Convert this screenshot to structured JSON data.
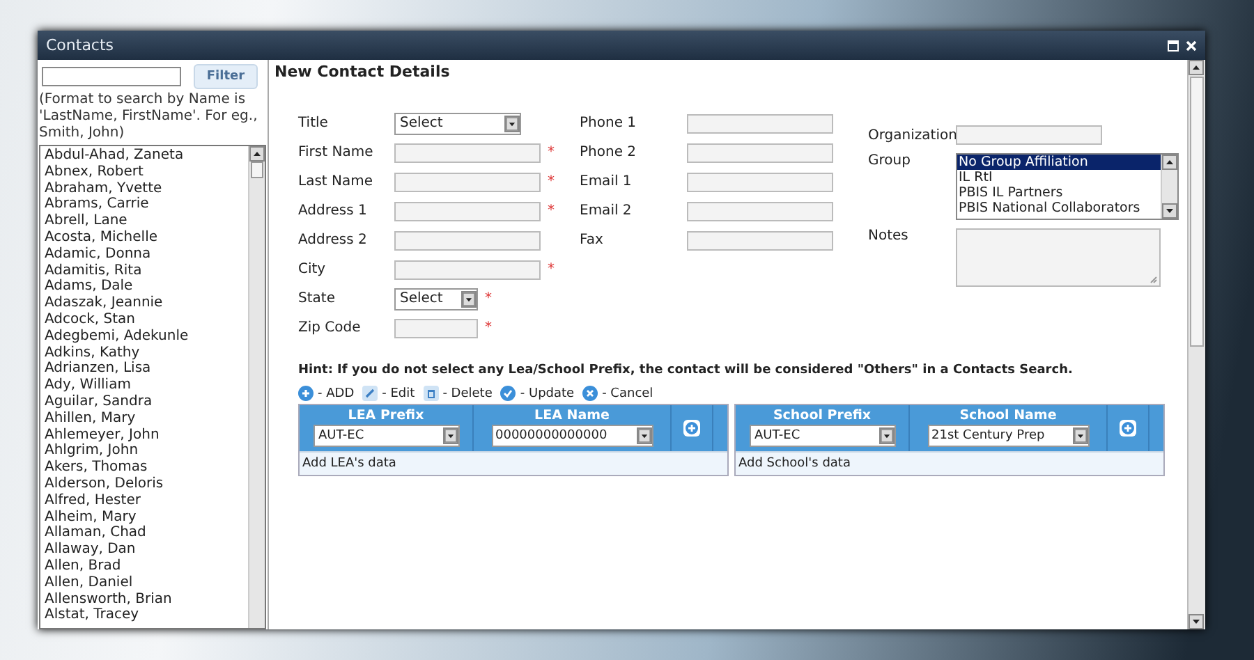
{
  "window": {
    "title": "Contacts"
  },
  "sidebar": {
    "filter_button": "Filter",
    "help": "(Format to search by Name is 'LastName, FirstName'. For eg., Smith, John)",
    "contacts": [
      "Abdul-Ahad, Zaneta",
      "Abnex, Robert",
      "Abraham, Yvette",
      "Abrams, Carrie",
      "Abrell, Lane",
      "Acosta, Michelle",
      "Adamic, Donna",
      "Adamitis, Rita",
      "Adams, Dale",
      "Adaszak, Jeannie",
      "Adcock, Stan",
      "Adegbemi, Adekunle",
      "Adkins, Kathy",
      "Adrianzen, Lisa",
      "Ady, William",
      "Aguilar, Sandra",
      "Ahillen, Mary",
      "Ahlemeyer, John",
      "Ahlgrim, John",
      "Akers, Thomas",
      "Alderson, Deloris",
      "Alfred, Hester",
      "Alheim, Mary",
      "Allaman, Chad",
      "Allaway, Dan",
      "Allen, Brad",
      "Allen, Daniel",
      "Allensworth, Brian",
      "Alstat, Tracey"
    ]
  },
  "form": {
    "heading": "New Contact Details",
    "column_1": [
      {
        "label": "Title",
        "kind": "select",
        "value": "Select"
      },
      {
        "label": "First Name",
        "kind": "text",
        "required_mark": "*"
      },
      {
        "label": "Last Name",
        "kind": "text",
        "required_mark": "*"
      },
      {
        "label": "Address 1",
        "kind": "text",
        "required_mark": "*"
      },
      {
        "label": "Address 2",
        "kind": "text"
      },
      {
        "label": "City",
        "kind": "text",
        "required_mark": "*"
      },
      {
        "label": "State",
        "kind": "select",
        "value": "Select",
        "required_mark": "*"
      },
      {
        "label": "Zip Code",
        "kind": "text",
        "required_mark": "*"
      }
    ],
    "column_2": [
      {
        "label": "Phone 1",
        "kind": "text"
      },
      {
        "label": "Phone 2",
        "kind": "text"
      },
      {
        "label": "Email 1",
        "kind": "text"
      },
      {
        "label": "Email 2",
        "kind": "text"
      },
      {
        "label": "Fax",
        "kind": "text"
      }
    ],
    "organization": {
      "label": "Organization"
    },
    "group": {
      "label": "Group",
      "options": [
        {
          "text": "No Group Affiliation",
          "selected": true
        },
        {
          "text": "IL RtI",
          "selected": false
        },
        {
          "text": "PBIS IL Partners",
          "selected": false
        },
        {
          "text": "PBIS National Collaborators",
          "selected": false
        }
      ]
    },
    "notes": {
      "label": "Notes"
    },
    "hint": "**Hint: If you do not select any Lea/School Prefix, the contact will be considered \"Others\" in a Contacts Search.**",
    "legend": [
      {
        "kind": "add",
        "label": "- ADD"
      },
      {
        "kind": "edit",
        "label": "- Edit"
      },
      {
        "kind": "delete",
        "label": "- Delete"
      },
      {
        "kind": "update",
        "label": "- Update"
      },
      {
        "kind": "cancel",
        "label": "- Cancel"
      }
    ],
    "tables": [
      {
        "columns": [
          {
            "heading": "LEA Prefix",
            "value": "AUT-EC"
          },
          {
            "heading": "LEA Name",
            "value": "00000000000000"
          }
        ],
        "footer": "Add LEA's data"
      },
      {
        "columns": [
          {
            "heading": "School Prefix",
            "value": "AUT-EC"
          },
          {
            "heading": "School Name",
            "value": "21st Century Prep"
          }
        ],
        "footer": "Add School's data"
      }
    ]
  }
}
